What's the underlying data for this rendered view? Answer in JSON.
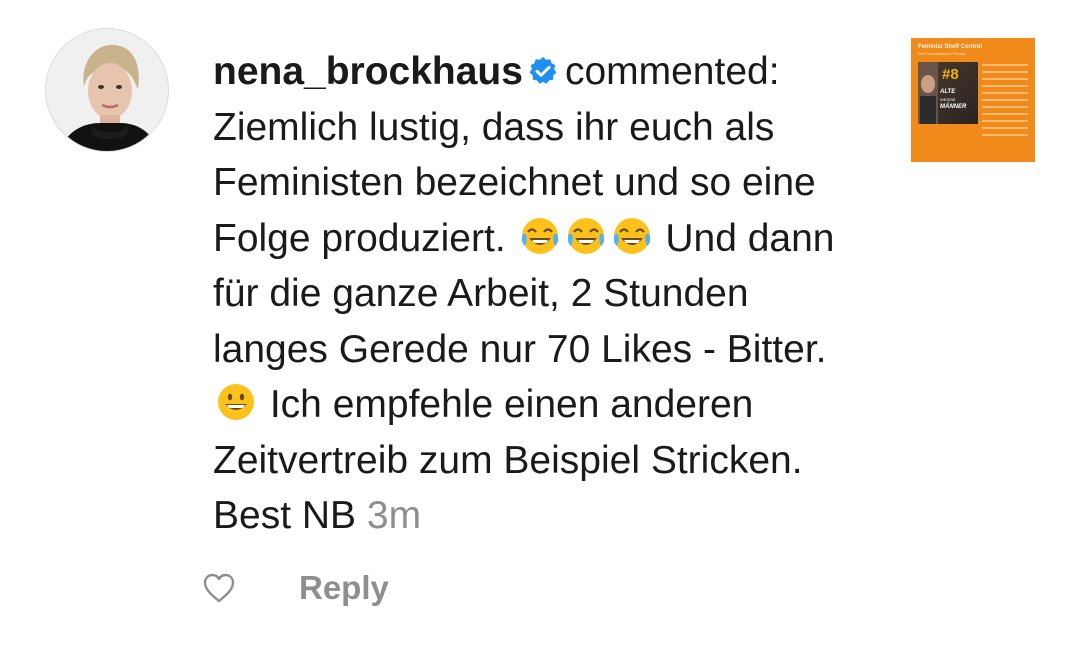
{
  "comment": {
    "username": "nena_brockhaus",
    "verb": "commented:",
    "text_part1": "Ziemlich lustig, dass ihr euch als Feministen bezeichnet und so eine Folge produziert.",
    "emoji_group1": [
      "face-with-tears-of-joy",
      "face-with-tears-of-joy",
      "face-with-tears-of-joy"
    ],
    "text_part2": "Und dann für die ganze Arbeit, 2 Stunden langes Gerede nur 70 Likes - Bitter.",
    "emoji_group2": "grinning-face",
    "text_part3": "Ich empfehle einen anderen Zeitvertreib zum Beispiel Stricken. Best NB",
    "timestamp": "3m"
  },
  "post_thumbnail": {
    "title": "Feminist Shelf Control",
    "subtitle": "Der Feministische Podcast",
    "episode": "#8",
    "cover_line1": "ALTE",
    "cover_line2": "WEISSE",
    "cover_line3": "MÄNNER"
  },
  "actions": {
    "like_icon": "heart-outline-icon",
    "reply_label": "Reply"
  },
  "colors": {
    "text": "#1a1a1a",
    "muted": "#8e8e8e",
    "verified_badge": "#1f8ff2",
    "thumbnail_bg": "#f08a1a"
  }
}
